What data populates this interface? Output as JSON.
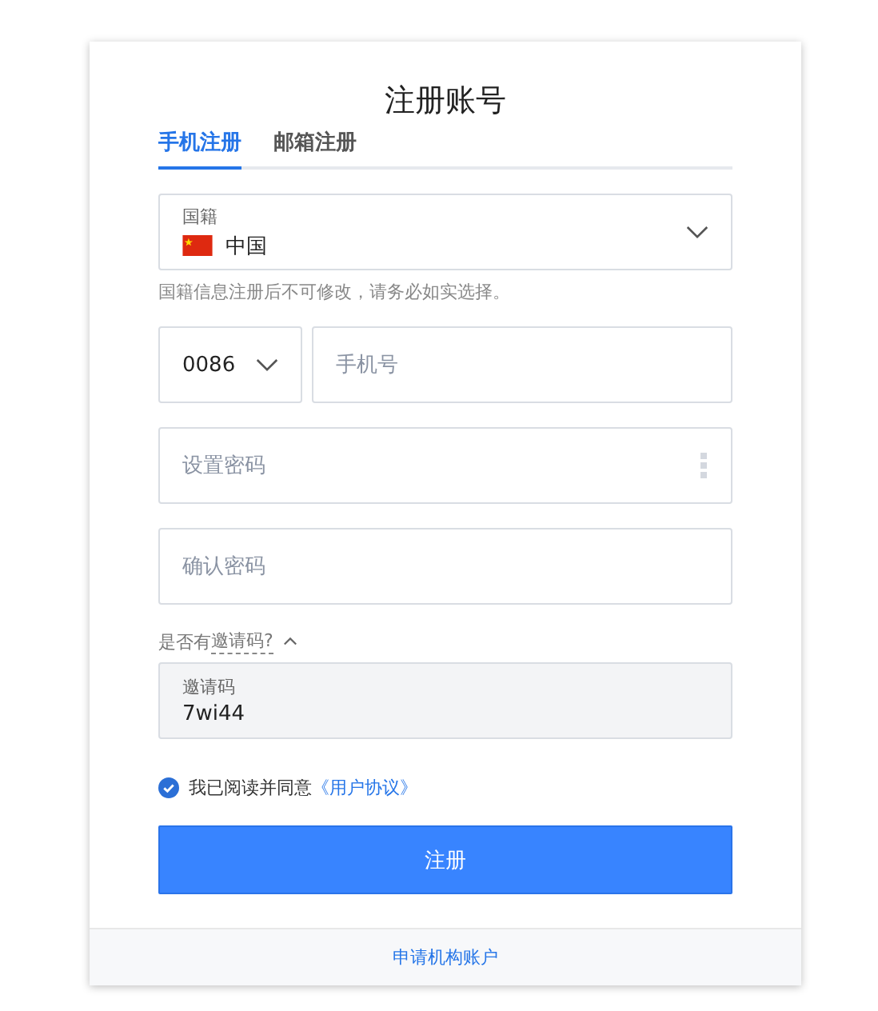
{
  "title": "注册账号",
  "tabs": [
    {
      "label": "手机注册",
      "selected": true
    },
    {
      "label": "邮箱注册",
      "selected": false
    }
  ],
  "nationality": {
    "label": "国籍",
    "value": "中国",
    "hint": "国籍信息注册后不可修改，请务必如实选择。"
  },
  "phone": {
    "code": "0086",
    "placeholder": "手机号"
  },
  "password": {
    "placeholder": "设置密码"
  },
  "confirm_password": {
    "placeholder": "确认密码"
  },
  "invite": {
    "question": "是否有",
    "link": "邀请码?",
    "expanded": true,
    "label": "邀请码",
    "value": "7wi44"
  },
  "agreement": {
    "checked": true,
    "text": "我已阅读并同意",
    "link": "《用户协议》"
  },
  "submit": "注册",
  "footer_link": "申请机构账户"
}
